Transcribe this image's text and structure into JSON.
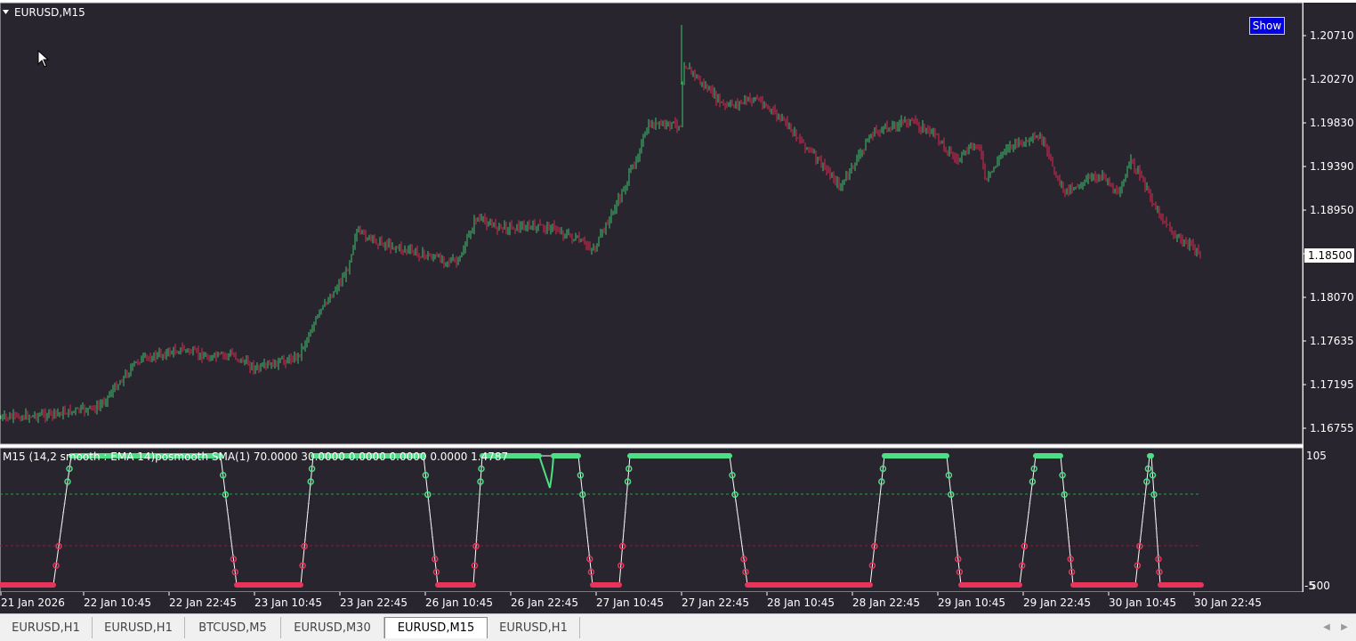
{
  "window": {
    "symbol_label": "EURUSD,M15",
    "show_button": "Show"
  },
  "price_axis": {
    "labels": [
      "1.20710",
      "1.20270",
      "1.19830",
      "1.19390",
      "1.18950",
      "1.18510",
      "1.18070",
      "1.17635",
      "1.17195",
      "1.16755"
    ],
    "current_price": "1.18500"
  },
  "indicator": {
    "label": "M15  (14,2 smooth : EMA  14)posmooth SMA(1) 70.0000 30.0000 0.0000 0.0000 0.0000 1.4787",
    "axis_top": "105",
    "axis_bottom": "-5",
    "axis_bottom_overlay": "500",
    "levels": [
      70,
      30
    ],
    "colors": {
      "upper": "#4ddf86",
      "lower": "#e8345a",
      "line": "#ffffff"
    }
  },
  "time_axis": {
    "labels": [
      "21 Jan 2026",
      "22 Jan 10:45",
      "22 Jan 22:45",
      "23 Jan 10:45",
      "23 Jan 22:45",
      "26 Jan 10:45",
      "26 Jan 22:45",
      "27 Jan 10:45",
      "27 Jan 22:45",
      "28 Jan 10:45",
      "28 Jan 22:45",
      "29 Jan 10:45",
      "29 Jan 22:45",
      "30 Jan 10:45",
      "30 Jan 22:45"
    ]
  },
  "tabs": [
    {
      "label": "EURUSD,H1",
      "active": false
    },
    {
      "label": "EURUSD,H1",
      "active": false
    },
    {
      "label": "BTCUSD,M5",
      "active": false
    },
    {
      "label": "EURUSD,M30",
      "active": false
    },
    {
      "label": "EURUSD,M15",
      "active": true
    },
    {
      "label": "EURUSD,H1",
      "active": false
    }
  ],
  "colors": {
    "background": "#28252e",
    "bull_candle": "#3ec46d",
    "bear_candle": "#e02850"
  },
  "icons": {
    "collapse": "triangle-down-icon",
    "cursor": "mouse-pointer-icon",
    "scroll_left": "arrow-left-icon",
    "scroll_right": "arrow-right-icon"
  }
}
